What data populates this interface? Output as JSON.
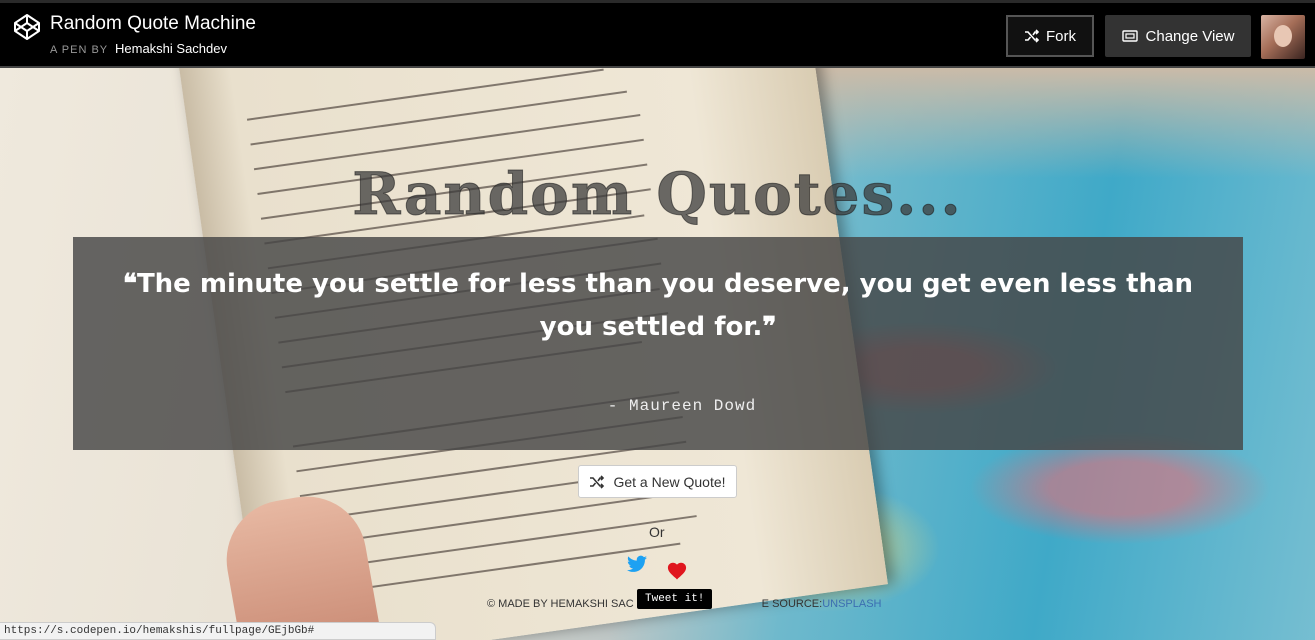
{
  "header": {
    "title": "Random Quote Machine",
    "byline_prefix": "A PEN BY",
    "author": "Hemakshi Sachdev",
    "fork_label": "Fork",
    "change_view_label": "Change View"
  },
  "app": {
    "heading": "Random Quotes...",
    "quote": "The minute you settle for less than you deserve, you get even less than you settled for.",
    "open_quote_mark": "❝",
    "close_quote_mark": "❞",
    "author": "- Maureen Dowd",
    "new_quote_label": "Get a New Quote!",
    "or_label": "Or",
    "tooltip": "Tweet it!",
    "footer_prefix": "© MADE BY HEMAKSHI SAC",
    "footer_middle": "E SOURCE:",
    "footer_link": "UNSPLASH"
  },
  "status_bar": {
    "url": "https://s.codepen.io/hemakshis/fullpage/GEjbGb#"
  },
  "colors": {
    "header_bg": "#000000",
    "twitter_blue": "#1da1f2",
    "heart_red": "#e0161e",
    "quote_box": "#464646"
  }
}
